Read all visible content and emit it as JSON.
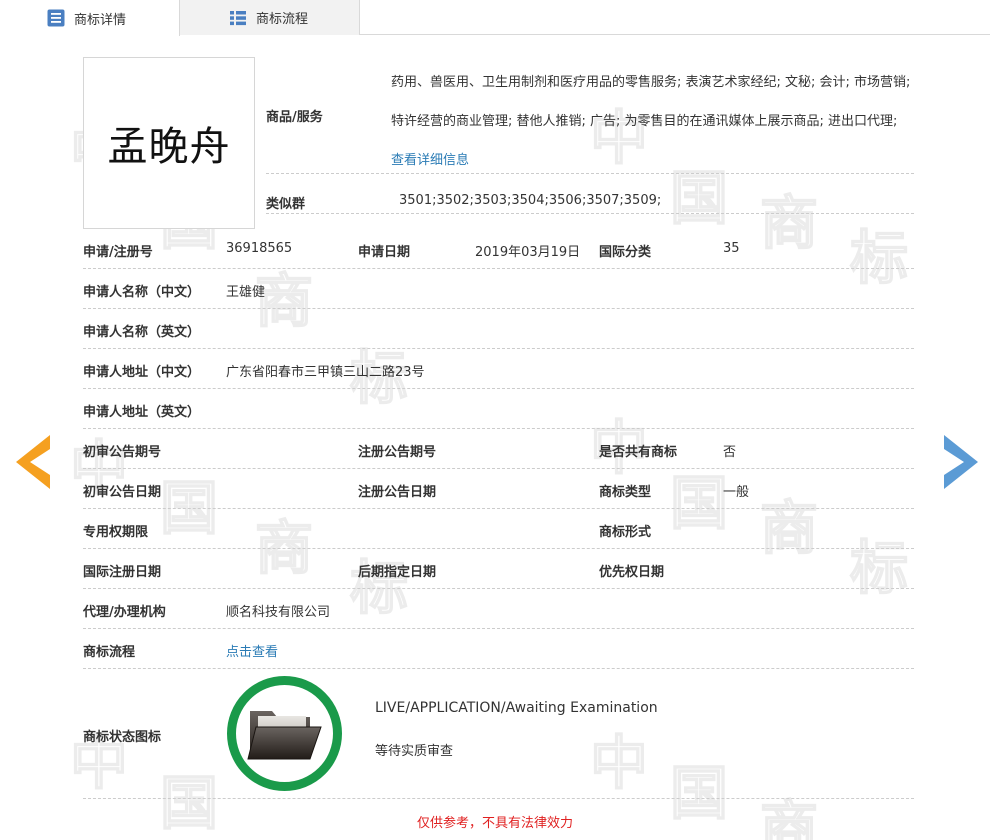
{
  "tabs": {
    "detail": {
      "label": "商标详情",
      "icon": "list-doc-icon"
    },
    "flow": {
      "label": "商标流程",
      "icon": "grid-list-icon"
    }
  },
  "trademark": {
    "logo_text": "孟晚舟",
    "goods_label": "商品/服务",
    "goods_text": "药用、兽医用、卫生用制剂和医疗用品的零售服务; 表演艺术家经纪; 文秘; 会计; 市场营销; 特许经营的商业管理; 替他人推销; 广告; 为零售目的在通讯媒体上展示商品; 进出口代理;",
    "goods_link": "查看详细信息",
    "similar_label": "类似群",
    "similar_value": "3501;3502;3503;3504;3506;3507;3509;"
  },
  "fields": {
    "reg_no_label": "申请/注册号",
    "reg_no_value": "36918565",
    "apply_date_label": "申请日期",
    "apply_date_value": "2019年03月19日",
    "intl_class_label": "国际分类",
    "intl_class_value": "35",
    "applicant_cn_label": "申请人名称（中文）",
    "applicant_cn_value": "王雄健",
    "applicant_en_label": "申请人名称（英文）",
    "address_cn_label": "申请人地址（中文）",
    "address_cn_value": "广东省阳春市三甲镇三山二路23号",
    "address_en_label": "申请人地址（英文）",
    "prelim_pub_no_label": "初审公告期号",
    "reg_pub_no_label": "注册公告期号",
    "shared_label": "是否共有商标",
    "shared_value": "否",
    "prelim_pub_date_label": "初审公告日期",
    "reg_pub_date_label": "注册公告日期",
    "tm_type_label": "商标类型",
    "tm_type_value": "一般",
    "exclusive_period_label": "专用权期限",
    "tm_form_label": "商标形式",
    "intl_reg_date_label": "国际注册日期",
    "later_date_label": "后期指定日期",
    "priority_date_label": "优先权日期",
    "agency_label": "代理/办理机构",
    "agency_value": "顺名科技有限公司",
    "process_label": "商标流程",
    "process_link": "点击查看",
    "status_label": "商标状态图标",
    "status_en": "LIVE/APPLICATION/Awaiting Examination",
    "status_cn": "等待实质审查"
  },
  "footer": {
    "note": "仅供参考，不具有法律效力"
  },
  "watermark": {
    "chars": [
      "中",
      "国",
      "商",
      "标"
    ]
  },
  "colors": {
    "link": "#2a7bb5",
    "arrow_left": "#f5a020",
    "arrow_right": "#5b9bd5",
    "status_ring": "#1a9a4a",
    "footer_note": "#e02020"
  }
}
